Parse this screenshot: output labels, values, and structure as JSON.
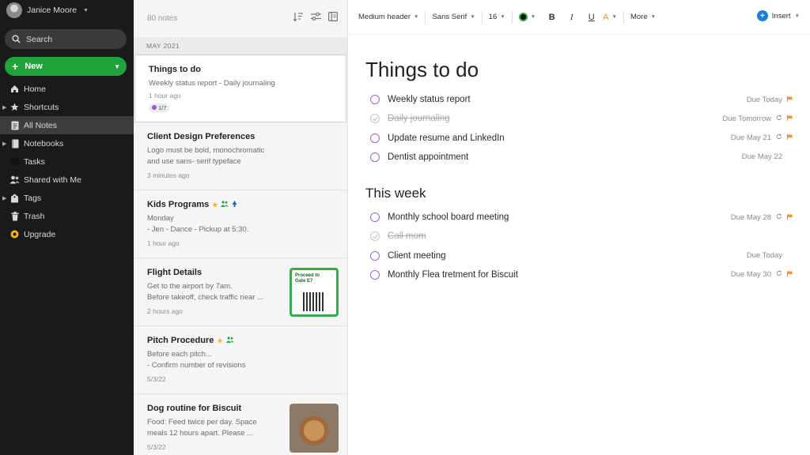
{
  "user": {
    "name": "Janice Moore"
  },
  "sidebar": {
    "search_label": "Search",
    "new_label": "New",
    "items": [
      {
        "label": "Home",
        "icon": "home-icon",
        "caret": false,
        "active": false
      },
      {
        "label": "Shortcuts",
        "icon": "star-icon",
        "caret": true,
        "active": false
      },
      {
        "label": "All Notes",
        "icon": "notes-icon",
        "caret": false,
        "active": true
      },
      {
        "label": "Notebooks",
        "icon": "notebook-icon",
        "caret": true,
        "active": false
      },
      {
        "label": "Tasks",
        "icon": "tasks-icon",
        "caret": false,
        "active": false
      },
      {
        "label": "Shared with Me",
        "icon": "people-icon",
        "caret": false,
        "active": false
      },
      {
        "label": "Tags",
        "icon": "tag-icon",
        "caret": true,
        "active": false
      },
      {
        "label": "Trash",
        "icon": "trash-icon",
        "caret": false,
        "active": false
      },
      {
        "label": "Upgrade",
        "icon": "upgrade-icon",
        "caret": false,
        "active": false
      }
    ]
  },
  "notelist": {
    "count": "80 notes",
    "month": "MAY 2021",
    "notes": [
      {
        "title": "Things to do",
        "snippet": "Weekly status report - Daily journaling",
        "time": "1 hour ago",
        "badge": "1/7"
      },
      {
        "title": "Client Design Preferences",
        "snippet": "Logo must be bold, monochromatic\nand use sans- serif typeface",
        "time": "3 minutes ago"
      },
      {
        "title": "Kids Programs",
        "snippet": "Monday\n- Jen - Dance - Pickup at 5:30.",
        "time": "1 hour ago"
      },
      {
        "title": "Flight Details",
        "snippet": "Get to the airport by 7am.\nBefore takeoff, check traffic near ...",
        "time": "2 hours ago",
        "thumb_text": "Proceed to Gate E7"
      },
      {
        "title": "Pitch Procedure",
        "snippet": "Before each pitch...\n-  Confirm number of revisions",
        "time": "5/3/22"
      },
      {
        "title": "Dog routine for Biscuit",
        "snippet": "Food: Feed twice per day. Space\nmeals 12 hours apart. Please ...",
        "time": "5/3/22"
      }
    ]
  },
  "toolbar": {
    "header_style": "Medium header",
    "font": "Sans Serif",
    "size": "16",
    "bold": "B",
    "italic": "I",
    "underline": "U",
    "highlight": "A",
    "more": "More",
    "insert": "Insert"
  },
  "editor": {
    "title": "Things to do",
    "section2": "This week",
    "tasks_today": [
      {
        "text": "Weekly status report",
        "due": "Due Today",
        "done": false,
        "repeat": false,
        "flag": true
      },
      {
        "text": "Daily journaling",
        "due": "Due Tomorrow",
        "done": true,
        "repeat": true,
        "flag": true
      },
      {
        "text": "Update resume and LinkedIn",
        "due": "Due May 21",
        "done": false,
        "repeat": true,
        "flag": true
      },
      {
        "text": "Dentist appointment",
        "due": "Due May 22",
        "done": false,
        "repeat": false,
        "flag": false
      }
    ],
    "tasks_week": [
      {
        "text": "Monthly school board meeting",
        "due": "Due May 28",
        "done": false,
        "repeat": true,
        "flag": true
      },
      {
        "text": "Call mom",
        "due": "",
        "done": true,
        "repeat": false,
        "flag": false
      },
      {
        "text": "Client meeting",
        "due": "Due Today",
        "done": false,
        "repeat": false,
        "flag": false
      },
      {
        "text": "Monthly Flea tretment for Biscuit",
        "due": "Due May 30",
        "done": false,
        "repeat": true,
        "flag": true
      }
    ]
  },
  "colors": {
    "sidebar_bg": "#1a1a1a",
    "accent_green": "#1fa33b",
    "task_circle": "#a067d0",
    "flag": "#e89a1c",
    "insert_blue": "#1e7ed6"
  }
}
